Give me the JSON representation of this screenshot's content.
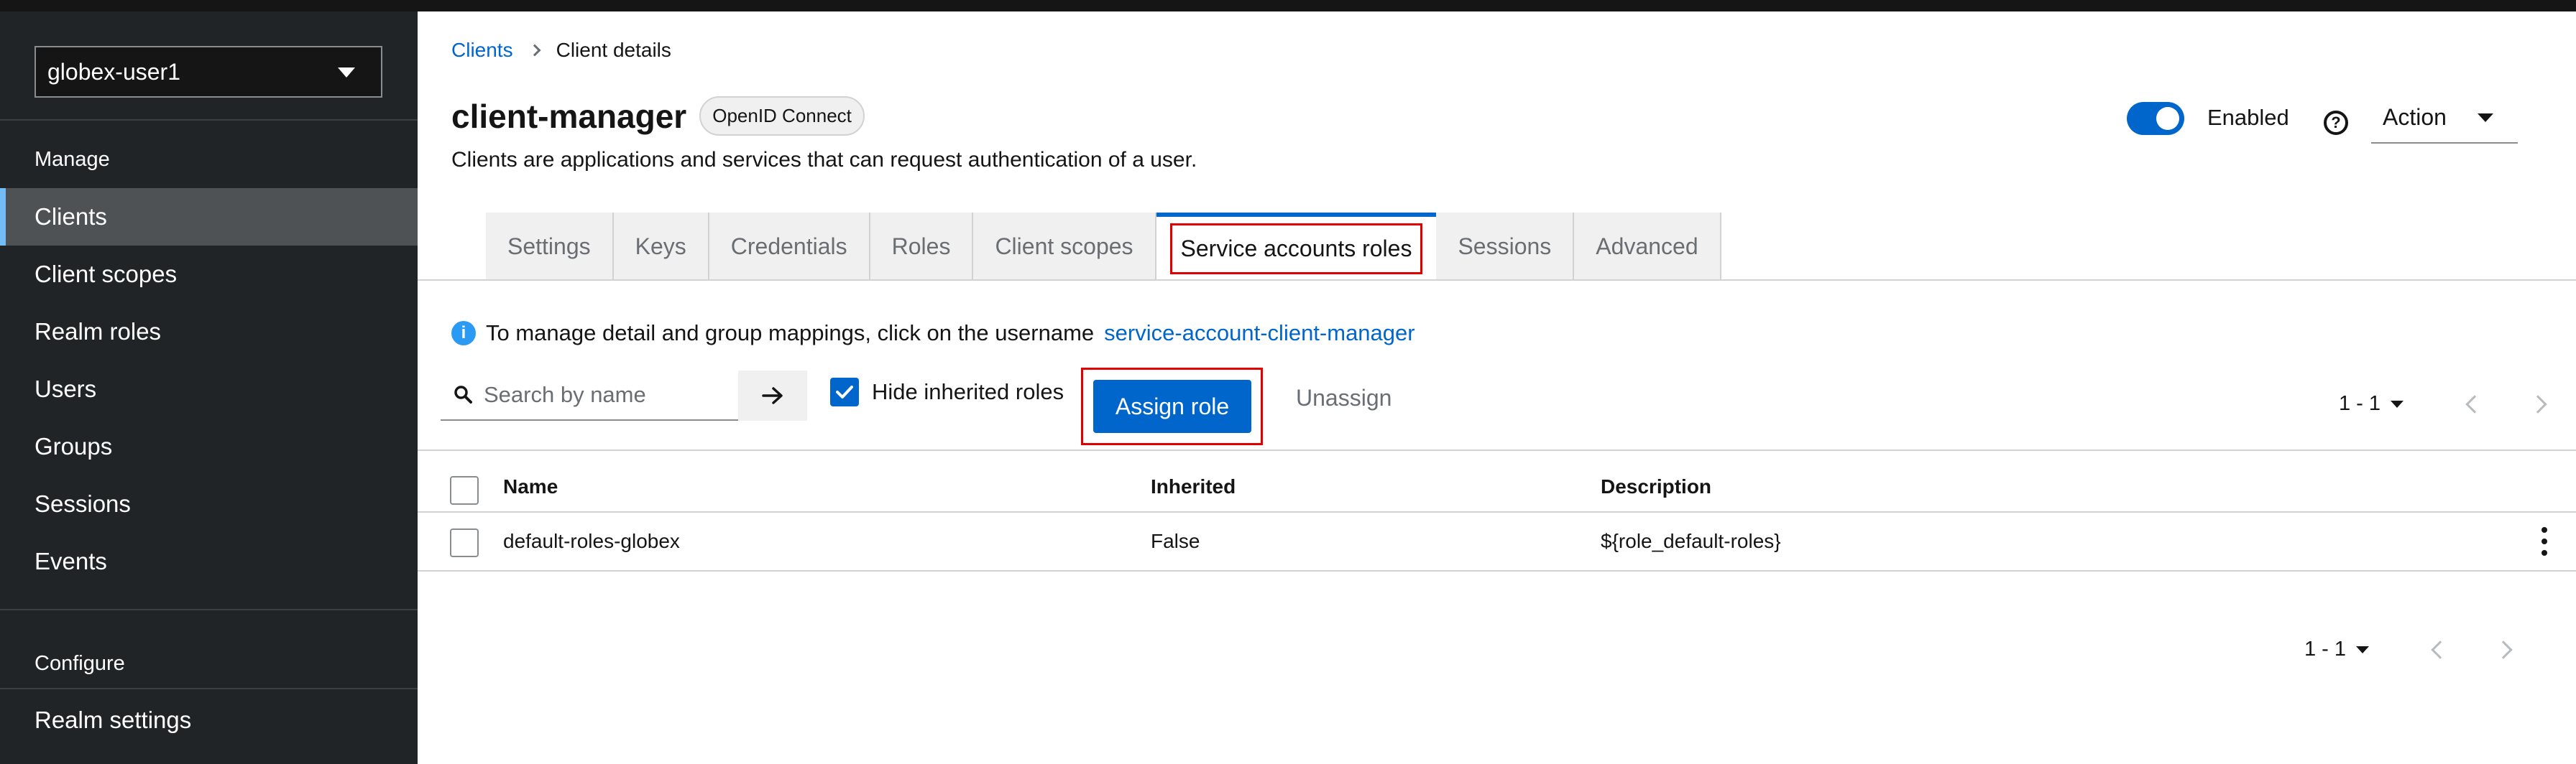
{
  "sidebar": {
    "realm": "globex-user1",
    "manage_title": "Manage",
    "items": [
      {
        "label": "Clients"
      },
      {
        "label": "Client scopes"
      },
      {
        "label": "Realm roles"
      },
      {
        "label": "Users"
      },
      {
        "label": "Groups"
      },
      {
        "label": "Sessions"
      },
      {
        "label": "Events"
      }
    ],
    "configure_title": "Configure",
    "configure_items": [
      {
        "label": "Realm settings"
      }
    ]
  },
  "breadcrumb": {
    "root": "Clients",
    "current": "Client details"
  },
  "header": {
    "title": "client-manager",
    "badge": "OpenID Connect",
    "subtitle": "Clients are applications and services that can request authentication of a user.",
    "enabled_label": "Enabled",
    "enabled": true,
    "help_icon_glyph": "?",
    "action_label": "Action"
  },
  "tabs": [
    {
      "label": "Settings"
    },
    {
      "label": "Keys"
    },
    {
      "label": "Credentials"
    },
    {
      "label": "Roles"
    },
    {
      "label": "Client scopes"
    },
    {
      "label": "Service accounts roles",
      "active": true
    },
    {
      "label": "Sessions"
    },
    {
      "label": "Advanced"
    }
  ],
  "info": {
    "icon_glyph": "i",
    "text": "To manage detail and group mappings, click on the username",
    "link": "service-account-client-manager"
  },
  "toolbar": {
    "search_placeholder": "Search by name",
    "hide_inherited_label": "Hide inherited roles",
    "hide_inherited_checked": true,
    "assign_label": "Assign role",
    "unassign_label": "Unassign",
    "pagination": "1 - 1"
  },
  "table": {
    "columns": [
      "Name",
      "Inherited",
      "Description"
    ],
    "rows": [
      {
        "name": "default-roles-globex",
        "inherited": "False",
        "description": "${role_default-roles}"
      }
    ]
  },
  "footer": {
    "pagination": "1 - 1"
  },
  "colors": {
    "accent": "#0066cc",
    "highlight": "#e00000",
    "sidebar_bg": "#212427"
  }
}
